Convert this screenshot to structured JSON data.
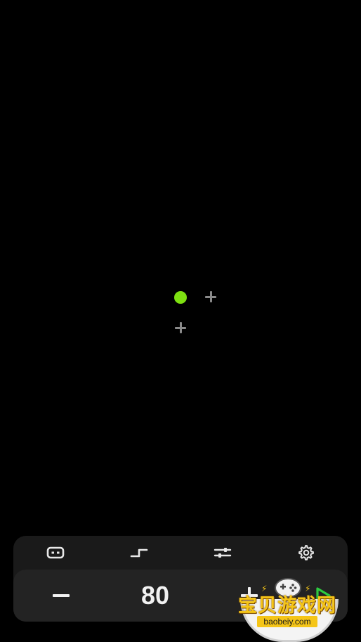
{
  "canvas": {
    "active_beat_color": "#7ee011",
    "marker_icon": "plus-icon"
  },
  "toolbar": {
    "items": [
      {
        "name": "visual-mode",
        "icon": "display-icon"
      },
      {
        "name": "step-pattern",
        "icon": "step-icon"
      },
      {
        "name": "sliders",
        "icon": "sliders-icon"
      },
      {
        "name": "settings",
        "icon": "gear-icon"
      }
    ]
  },
  "tempo": {
    "value": "80",
    "decrease_icon": "minus-icon",
    "increase_icon": "plus-icon",
    "play_icon": "play-icon",
    "play_color": "#2ecc40"
  },
  "watermark": {
    "title": "宝贝游戏网",
    "url": "baobeiy.com"
  }
}
